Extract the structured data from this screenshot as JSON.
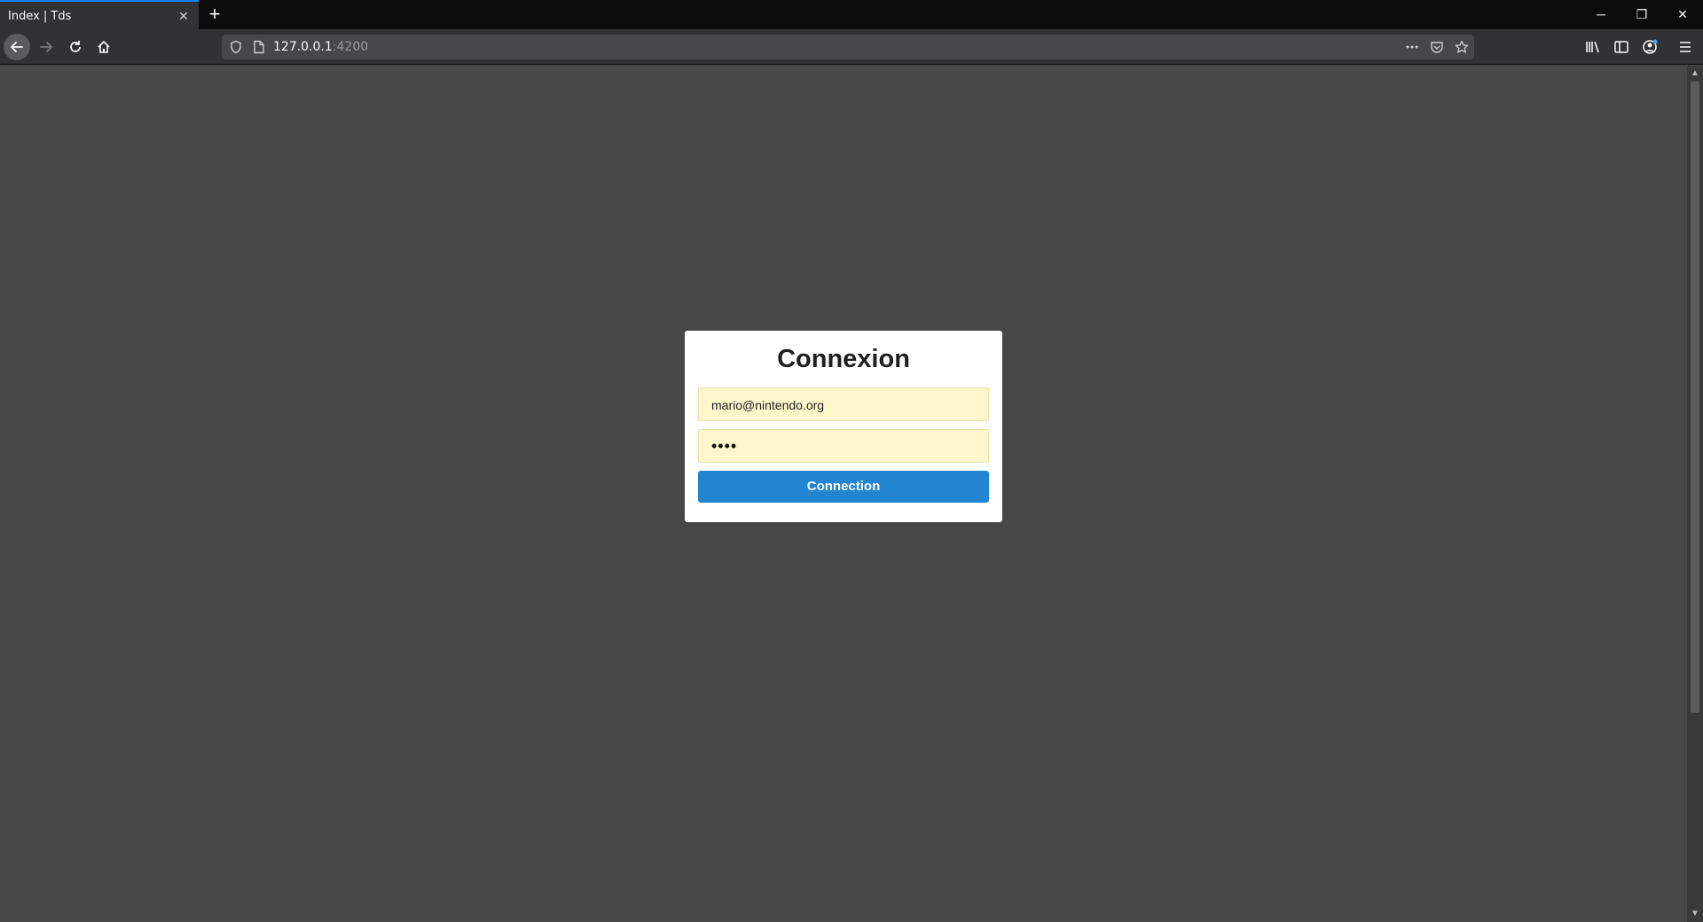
{
  "browser": {
    "tab_title": "Index | Tds",
    "tab_close": "✕",
    "new_tab": "+",
    "url_host": "127.0.0.1",
    "url_port": ":4200",
    "window_controls": {
      "minimize": "─",
      "restore": "❐",
      "close": "✕"
    },
    "icons": [
      "back-icon",
      "forward-icon",
      "reload-icon",
      "home-icon",
      "shield-icon",
      "page-icon",
      "more-icon",
      "pocket-icon",
      "star-icon",
      "library-icon",
      "sidebar-icon",
      "account-icon",
      "menu-icon"
    ]
  },
  "login": {
    "title": "Connexion",
    "email_value": "mario@nintendo.org",
    "password_value": "••••",
    "submit_label": "Connection"
  },
  "colors": {
    "page_background": "#474747",
    "field_autofill": "#fff6cc",
    "button": "#2185d0",
    "tab_accent": "#0a84ff"
  }
}
